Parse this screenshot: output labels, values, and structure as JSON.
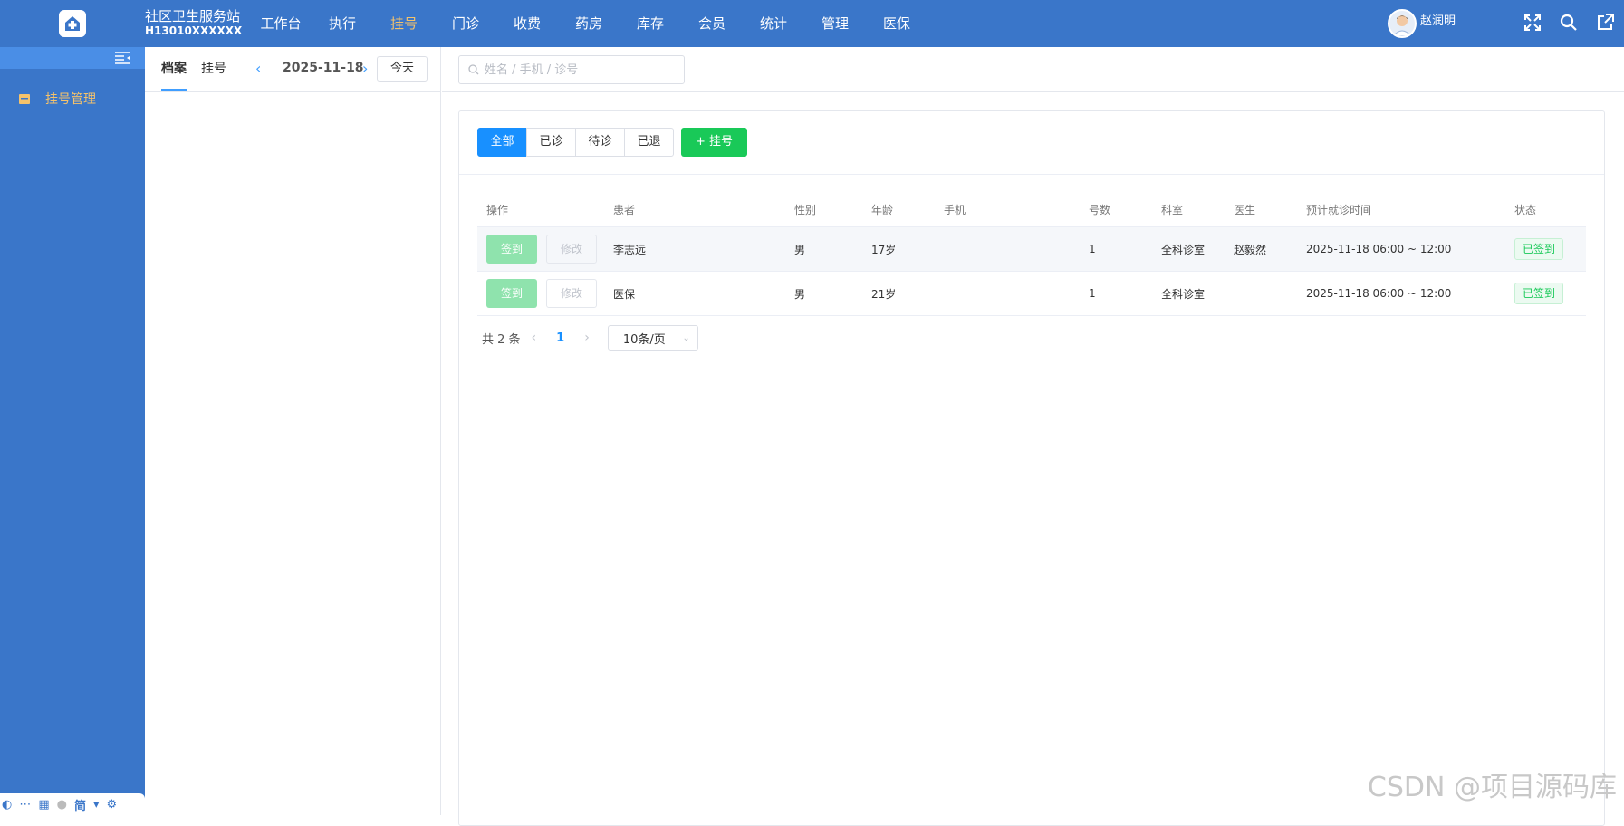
{
  "header": {
    "org_name": "社区卫生服务站",
    "org_code": "H13010XXXXXX",
    "nav": [
      {
        "label": "工作台"
      },
      {
        "label": "执行"
      },
      {
        "label": "挂号",
        "active": true
      },
      {
        "label": "门诊"
      },
      {
        "label": "收费"
      },
      {
        "label": "药房"
      },
      {
        "label": "库存"
      },
      {
        "label": "会员"
      },
      {
        "label": "统计"
      },
      {
        "label": "管理"
      },
      {
        "label": "医保"
      }
    ],
    "user_name": "赵润明",
    "icons": [
      "fullscreen-icon",
      "search-icon",
      "external-link-icon"
    ]
  },
  "sidebar": {
    "menu_label": "挂号管理",
    "tray_text": "简"
  },
  "left_panel": {
    "tabs": [
      "档案",
      "挂号"
    ],
    "date": "2025-11-18",
    "today_label": "今天"
  },
  "search": {
    "placeholder": "姓名 / 手机 / 诊号",
    "value": ""
  },
  "filters": {
    "segments": [
      "全部",
      "已诊",
      "待诊",
      "已退"
    ],
    "active": "全部",
    "add_label": "+ 挂号"
  },
  "table": {
    "columns": [
      "操作",
      "患者",
      "性别",
      "年龄",
      "手机",
      "号数",
      "科室",
      "医生",
      "预计就诊时间",
      "状态"
    ],
    "sign_label": "签到",
    "edit_label": "修改",
    "rows": [
      {
        "patient": "李志远",
        "sex": "男",
        "age": "17岁",
        "phone": "",
        "number": "1",
        "dept": "全科诊室",
        "doctor": "赵毅然",
        "time": "2025-11-18 06:00 ~ 12:00",
        "status": "已签到"
      },
      {
        "patient": "医保",
        "sex": "男",
        "age": "21岁",
        "phone": "",
        "number": "1",
        "dept": "全科诊室",
        "doctor": "",
        "time": "2025-11-18 06:00 ~ 12:00",
        "status": "已签到"
      }
    ]
  },
  "pagination": {
    "total_text": "共 2 条",
    "current_page": "1",
    "page_size": "10条/页"
  },
  "watermark": "CSDN @项目源码库",
  "colors": {
    "primary": "#3a76c9",
    "accent": "#f5c36b",
    "blue": "#1890ff",
    "green": "#19c958"
  }
}
